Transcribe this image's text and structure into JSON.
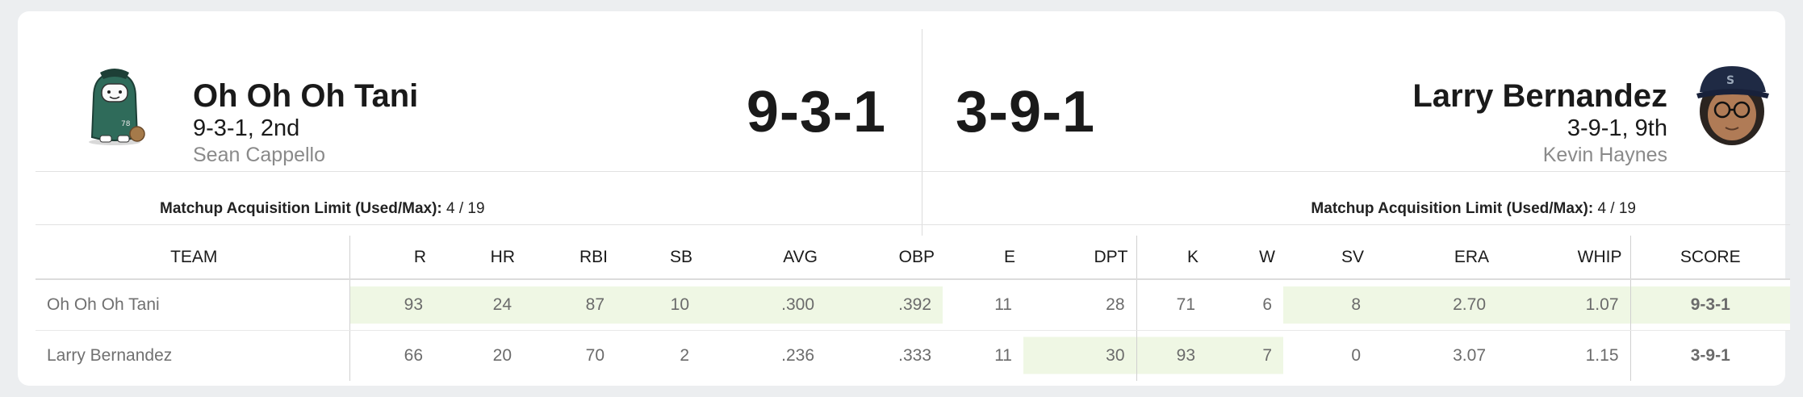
{
  "home": {
    "name": "Oh Oh Oh Tani",
    "record": "9-3-1, 2nd",
    "manager": "Sean Cappello",
    "score": "9-3-1",
    "acquisition_label": "Matchup Acquisition Limit (Used/Max):",
    "acquisition_value": "4 / 19",
    "avatar_icon": "cartoon-baseball-player-avatar-icon"
  },
  "away": {
    "name": "Larry Bernandez",
    "record": "3-9-1, 9th",
    "manager": "Kevin Haynes",
    "score": "3-9-1",
    "acquisition_label": "Matchup Acquisition Limit (Used/Max):",
    "acquisition_value": "4 / 19",
    "avatar_icon": "mariners-cap-person-avatar-icon"
  },
  "table": {
    "headers": [
      "TEAM",
      "R",
      "HR",
      "RBI",
      "SB",
      "AVG",
      "OBP",
      "E",
      "DPT",
      "K",
      "W",
      "SV",
      "ERA",
      "WHIP",
      "SCORE"
    ],
    "rows": [
      {
        "team": "Oh Oh Oh Tani",
        "R": "93",
        "HR": "24",
        "RBI": "87",
        "SB": "10",
        "AVG": ".300",
        "OBP": ".392",
        "E": "11",
        "DPT": "28",
        "K": "71",
        "W": "6",
        "SV": "8",
        "ERA": "2.70",
        "WHIP": "1.07",
        "SCORE": "9-3-1"
      },
      {
        "team": "Larry Bernandez",
        "R": "66",
        "HR": "20",
        "RBI": "70",
        "SB": "2",
        "AVG": ".236",
        "OBP": ".333",
        "E": "11",
        "DPT": "30",
        "K": "93",
        "W": "7",
        "SV": "0",
        "ERA": "3.07",
        "WHIP": "1.15",
        "SCORE": "3-9-1"
      }
    ]
  },
  "colors": {
    "win_highlight": "#eff7e4",
    "background": "#eceef0"
  }
}
